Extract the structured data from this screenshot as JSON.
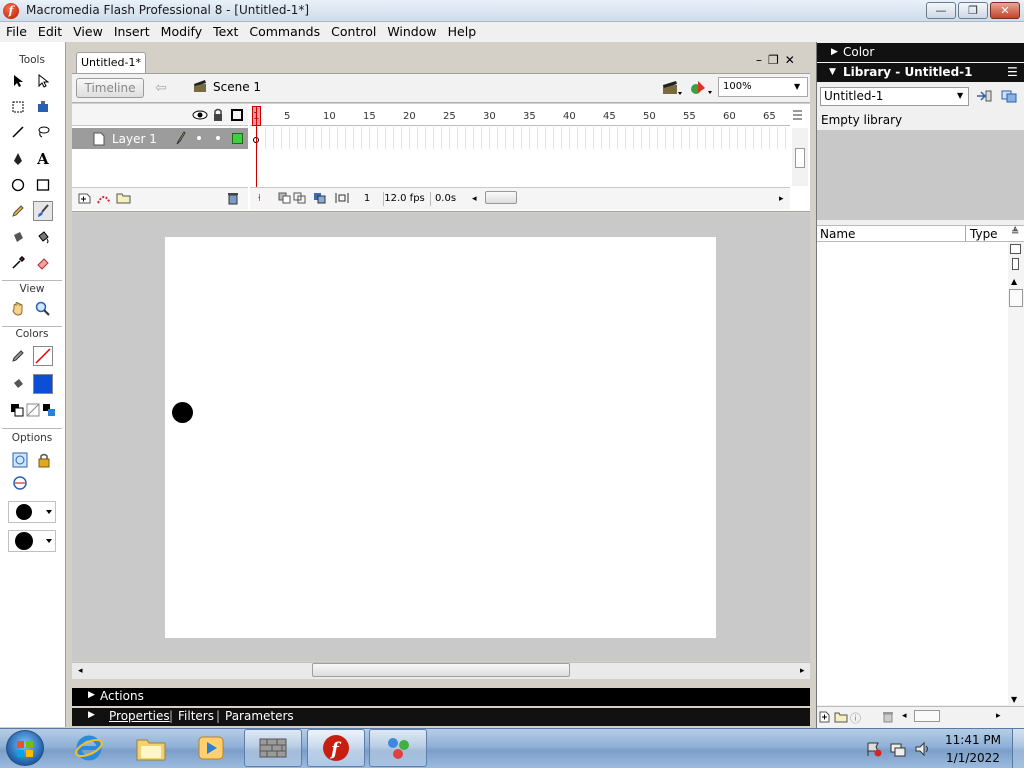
{
  "window": {
    "title": "Macromedia Flash Professional 8 - [Untitled-1*]",
    "minimize": "—",
    "restore": "❐",
    "close": "✕"
  },
  "menu": [
    "File",
    "Edit",
    "View",
    "Insert",
    "Modify",
    "Text",
    "Commands",
    "Control",
    "Window",
    "Help"
  ],
  "tools": {
    "heading": "Tools",
    "view_heading": "View",
    "colors_heading": "Colors",
    "options_heading": "Options"
  },
  "document": {
    "tab": "Untitled-1*",
    "timeline_button": "Timeline",
    "scene": "Scene 1",
    "zoom": "100%"
  },
  "timeline": {
    "layer_name": "Layer 1",
    "ruler_ticks": [
      "1",
      "5",
      "10",
      "15",
      "20",
      "25",
      "30",
      "35",
      "40",
      "45",
      "50",
      "55",
      "60",
      "65"
    ],
    "current_frame": "1",
    "frame_rate": "12.0 fps",
    "elapsed": "0.0s"
  },
  "panels": {
    "actions": "Actions",
    "properties": "Properties",
    "filters": "Filters",
    "parameters": "Parameters"
  },
  "right_panels": {
    "color": "Color",
    "library_title": "Library - Untitled-1",
    "library_select": "Untitled-1",
    "empty_label": "Empty library",
    "col_name": "Name",
    "col_type": "Type"
  },
  "clock": {
    "time": "11:41 PM",
    "date": "1/1/2022"
  },
  "colors": {
    "accent": "#1c5fa8",
    "fill_swatch": "#0a4fd6",
    "playhead": "#cc0000"
  }
}
